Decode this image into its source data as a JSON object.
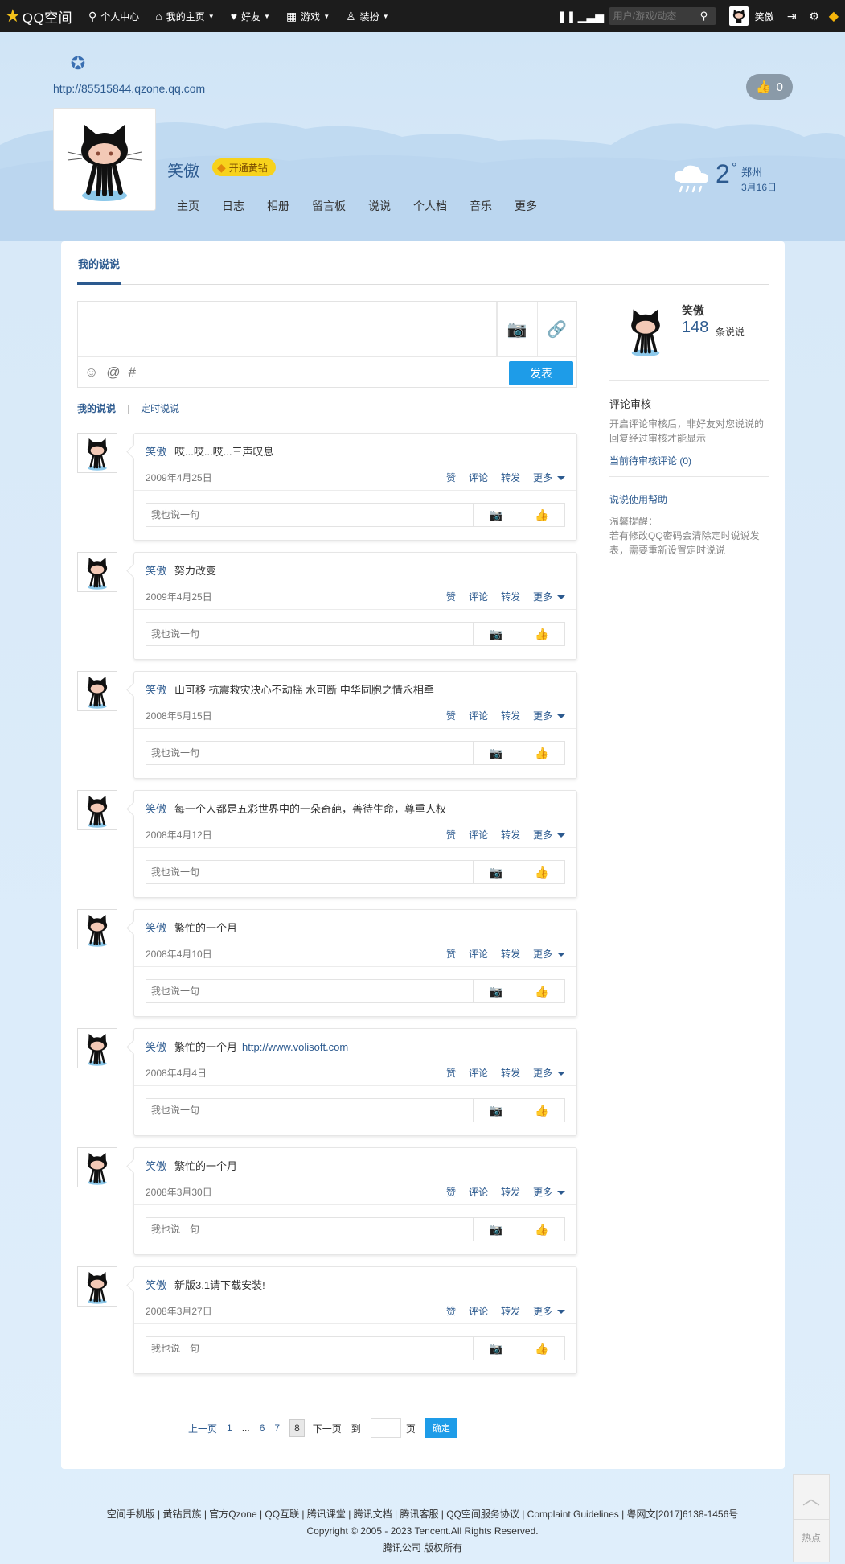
{
  "topbar": {
    "logo_text": "QQ空间",
    "nav": [
      {
        "icon": "user-icon",
        "label": "个人中心",
        "caret": false
      },
      {
        "icon": "home-icon",
        "label": "我的主页",
        "caret": true
      },
      {
        "icon": "friends-icon",
        "label": "好友",
        "caret": true
      },
      {
        "icon": "grid-icon",
        "label": "游戏",
        "caret": true
      },
      {
        "icon": "shirt-icon",
        "label": "装扮",
        "caret": true
      }
    ],
    "search_placeholder": "用户/游戏/动态",
    "user_name": "笑傲"
  },
  "header": {
    "url": "http://85515844.qzone.qq.com",
    "like_count": "0",
    "owner_name": "笑傲",
    "yellow_diamond_label": "开通黄钻",
    "nav": [
      "主页",
      "日志",
      "相册",
      "留言板",
      "说说",
      "个人档",
      "音乐",
      "更多"
    ],
    "weather": {
      "temp": "2",
      "deg": "°",
      "city": "郑州",
      "date": "3月16日"
    }
  },
  "panel": {
    "tab": "我的说说",
    "post_button": "发表",
    "subtabs": {
      "active": "我的说说",
      "other": "定时说说"
    },
    "reply_placeholder": "我也说一句",
    "actions": {
      "like": "赞",
      "comment": "评论",
      "forward": "转发",
      "more": "更多"
    },
    "feed": [
      {
        "user": "笑傲",
        "text": "哎...哎...哎...三声叹息",
        "link": "",
        "date": "2009年4月25日"
      },
      {
        "user": "笑傲",
        "text": "努力改变",
        "link": "",
        "date": "2009年4月25日"
      },
      {
        "user": "笑傲",
        "text": "山可移 抗震救灾决心不动摇 水可断 中华同胞之情永相牵",
        "link": "",
        "date": "2008年5月15日"
      },
      {
        "user": "笑傲",
        "text": "每一个人都是五彩世界中的一朵奇葩，善待生命，尊重人权",
        "link": "",
        "date": "2008年4月12日"
      },
      {
        "user": "笑傲",
        "text": "繁忙的一个月",
        "link": "",
        "date": "2008年4月10日"
      },
      {
        "user": "笑傲",
        "text": "繁忙的一个月",
        "link": "http://www.volisoft.com",
        "date": "2008年4月4日"
      },
      {
        "user": "笑傲",
        "text": "繁忙的一个月",
        "link": "",
        "date": "2008年3月30日"
      },
      {
        "user": "笑傲",
        "text": "新版3.1请下载安装!",
        "link": "",
        "date": "2008年3月27日"
      }
    ],
    "pager": {
      "prev": "上一页",
      "p1": "1",
      "dots": "...",
      "p6": "6",
      "p7": "7",
      "current": "8",
      "next": "下一页",
      "goto": "到",
      "page_unit": "页",
      "confirm": "确定"
    }
  },
  "sidebar": {
    "name": "笑傲",
    "count": "148",
    "count_label": "条说说",
    "review_title": "评论审核",
    "review_desc": "开启评论审核后，非好友对您说说的回复经过审核才能显示",
    "review_pending": "当前待审核评论 (0)",
    "help_link": "说说使用帮助",
    "tip_title": "温馨提醒：",
    "tip_text": "若有修改QQ密码会清除定时说说发表，需要重新设置定时说说"
  },
  "footer": {
    "links": "空间手机版 | 黄钻贵族 | 官方Qzone | QQ互联 | 腾讯课堂 | 腾讯文档 | 腾讯客服 | QQ空间服务协议 | Complaint Guidelines | 粤网文[2017]6138-1456号",
    "copyright": "Copyright © 2005 - 2023 Tencent.All Rights Reserved.",
    "company": "腾讯公司 版权所有",
    "hot": "热点"
  }
}
